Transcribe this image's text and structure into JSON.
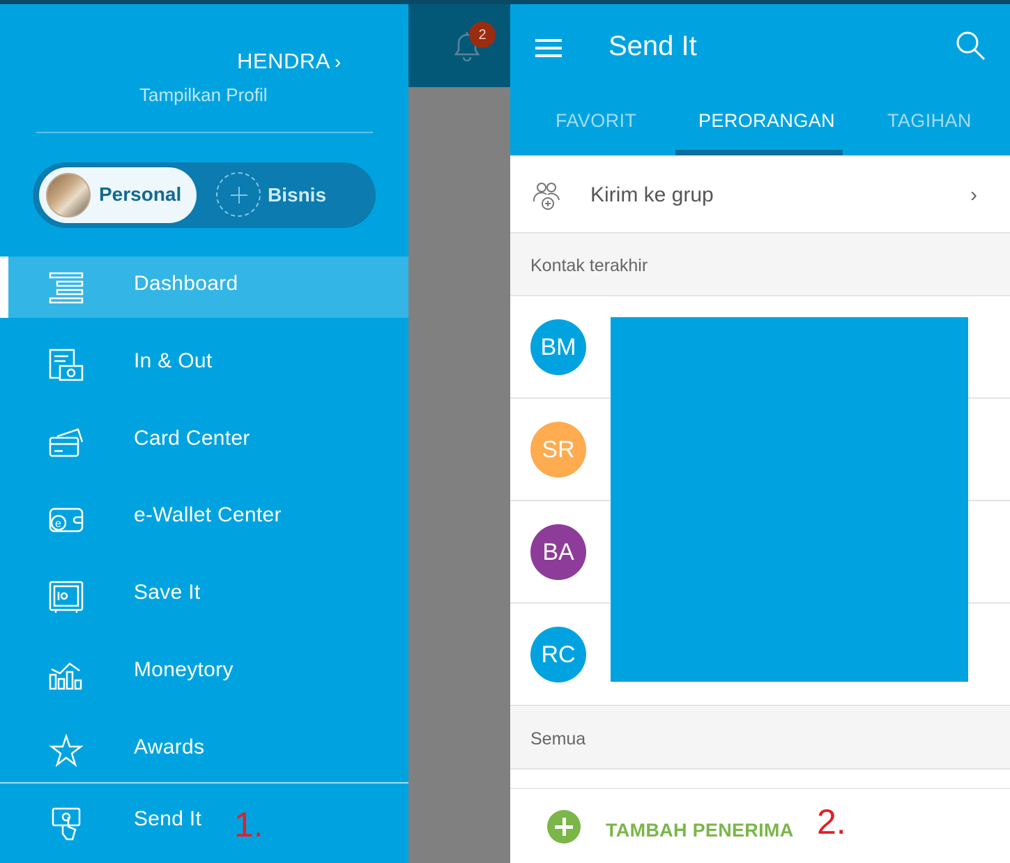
{
  "drawer": {
    "user_name": "HENDRA",
    "profile_link": "Tampilkan Profil",
    "accounts": {
      "personal": "Personal",
      "business": "Bisnis"
    },
    "menu": [
      {
        "label": "Dashboard",
        "icon": "dashboard-icon",
        "active": true
      },
      {
        "label": "In & Out",
        "icon": "in-out-icon"
      },
      {
        "label": "Card Center",
        "icon": "card-icon"
      },
      {
        "label": "e-Wallet Center",
        "icon": "ewallet-icon"
      },
      {
        "label": "Save It",
        "icon": "safe-icon"
      },
      {
        "label": "Moneytory",
        "icon": "chart-icon"
      },
      {
        "label": "Awards",
        "icon": "star-icon"
      },
      {
        "label": "Send It",
        "icon": "send-money-icon"
      }
    ],
    "annotation": "1."
  },
  "notifications": {
    "count": "2"
  },
  "screen": {
    "title": "Send It",
    "tabs": [
      "FAVORIT",
      "PERORANGAN",
      "TAGIHAN"
    ],
    "active_tab": "PERORANGAN",
    "group_row": "Kirim ke grup",
    "recent_header": "Kontak terakhir",
    "contacts": [
      {
        "initials": "BM",
        "color": "#00a3e0"
      },
      {
        "initials": "SR",
        "color": "#ffab50"
      },
      {
        "initials": "BA",
        "color": "#8e3c99"
      },
      {
        "initials": "RC",
        "color": "#00a3e0"
      }
    ],
    "all_header": "Semua",
    "add_recipient": "TAMBAH PENERIMA",
    "annotation": "2."
  },
  "colors": {
    "primary": "#00a3e0",
    "accent_green": "#7ab648",
    "annotation_red": "#e41e26"
  }
}
